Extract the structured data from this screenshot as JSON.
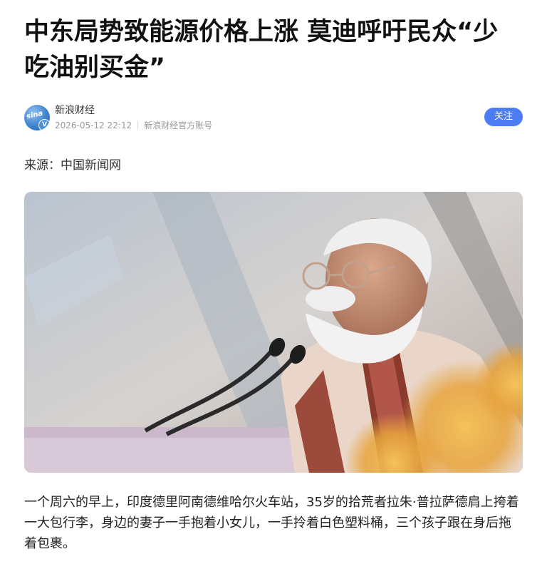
{
  "article": {
    "title": "中东局势致能源价格上涨 莫迪呼吁民众“少吃油别买金”",
    "author": {
      "avatar_text": "sina",
      "avatar_badge": "V",
      "name": "新浪财经",
      "datetime": "2026-05-12 22:12",
      "account_type": "新浪财经官方账号",
      "follow_label": "关注"
    },
    "source": "来源：中国新闻网",
    "image": {
      "icon": "news-photo"
    },
    "paragraph": "一个周六的早上，印度德里阿南德维哈尔火车站，35岁的拾荒者拉朱·普拉萨德肩上挎着一大包行李，身边的妻子一手抱着小女儿，一手拎着白色塑料桶，三个孩子跟在身后拖着包裹。"
  },
  "colors": {
    "follow_button": "#4e7cf3",
    "meta_text": "#999999",
    "title_text": "#111111"
  }
}
